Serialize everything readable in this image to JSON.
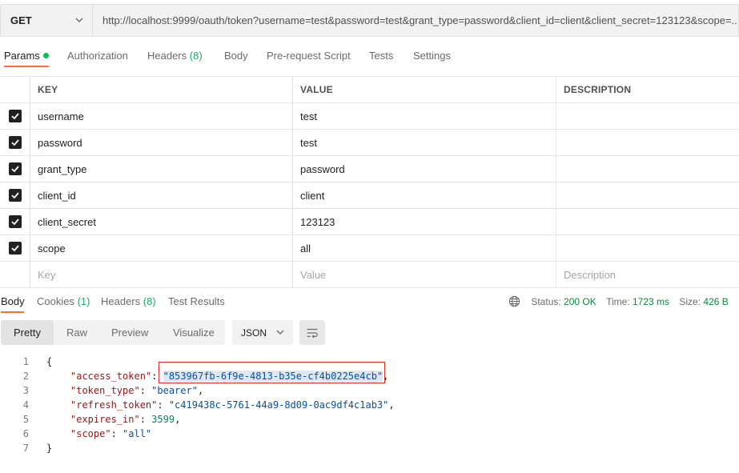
{
  "request": {
    "method": "GET",
    "url": "http://localhost:9999/oauth/token?username=test&password=test&grant_type=password&client_id=client&client_secret=123123&scope=..."
  },
  "request_tabs": [
    {
      "label": "Params",
      "count": ""
    },
    {
      "label": "Authorization",
      "count": ""
    },
    {
      "label": "Headers",
      "count": "(8)"
    },
    {
      "label": "Body",
      "count": ""
    },
    {
      "label": "Pre-request Script",
      "count": ""
    },
    {
      "label": "Tests",
      "count": ""
    },
    {
      "label": "Settings",
      "count": ""
    }
  ],
  "params": {
    "headers": {
      "key": "KEY",
      "value": "VALUE",
      "description": "DESCRIPTION"
    },
    "rows": [
      {
        "key": "username",
        "value": "test",
        "checked": true
      },
      {
        "key": "password",
        "value": "test",
        "checked": true
      },
      {
        "key": "grant_type",
        "value": "password",
        "checked": true
      },
      {
        "key": "client_id",
        "value": "client",
        "checked": true
      },
      {
        "key": "client_secret",
        "value": "123123",
        "checked": true
      },
      {
        "key": "scope",
        "value": "all",
        "checked": true
      }
    ],
    "placeholders": {
      "key": "Key",
      "value": "Value",
      "description": "Description"
    }
  },
  "response_tabs": [
    {
      "label": "Body",
      "count": ""
    },
    {
      "label": "Cookies",
      "count": "(1)"
    },
    {
      "label": "Headers",
      "count": "(8)"
    },
    {
      "label": "Test Results",
      "count": ""
    }
  ],
  "status": {
    "status_label": "Status:",
    "status_value": "200 OK",
    "time_label": "Time:",
    "time_value": "1723 ms",
    "size_label": "Size:",
    "size_value": "426 B"
  },
  "view": {
    "modes": [
      "Pretty",
      "Raw",
      "Preview",
      "Visualize"
    ],
    "format": "JSON"
  },
  "code": {
    "line_numbers": [
      "1",
      "2",
      "3",
      "4",
      "5",
      "6",
      "7"
    ],
    "open_brace": "{",
    "close_brace": "}",
    "fields": [
      {
        "key": "\"access_token\"",
        "value": "\"853967fb-6f9e-4813-b35e-cf4b0225e4cb\"",
        "type": "string",
        "comma": ","
      },
      {
        "key": "\"token_type\"",
        "value": "\"bearer\"",
        "type": "string",
        "comma": ","
      },
      {
        "key": "\"refresh_token\"",
        "value": "\"c419438c-5761-44a9-8d09-0ac9df4c1ab3\"",
        "type": "string",
        "comma": ","
      },
      {
        "key": "\"expires_in\"",
        "value": "3599",
        "type": "number",
        "comma": ","
      },
      {
        "key": "\"scope\"",
        "value": "\"all\"",
        "type": "string",
        "comma": ""
      }
    ]
  },
  "colors": {
    "accent_tab": "#ff6c37",
    "status_ok": "#0a8a3e",
    "highlight_box": "#d93025"
  }
}
